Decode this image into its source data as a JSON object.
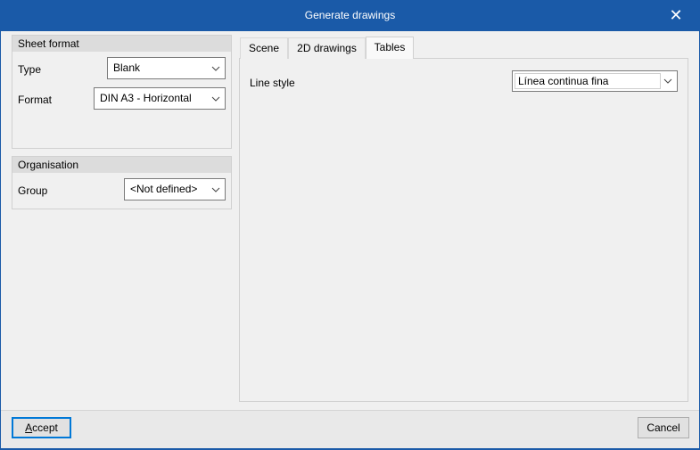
{
  "window": {
    "title": "Generate drawings",
    "close_icon": "close-icon"
  },
  "sheet_format": {
    "header": "Sheet format",
    "type_label": "Type",
    "type_value": "Blank",
    "format_label": "Format",
    "format_value": "DIN A3 - Horizontal"
  },
  "organisation": {
    "header": "Organisation",
    "group_label": "Group",
    "group_value": "<Not defined>"
  },
  "tabs": [
    {
      "label": "Scene"
    },
    {
      "label": "2D drawings"
    },
    {
      "label": "Tables",
      "active": true
    }
  ],
  "tables": {
    "line_style_label": "Line style",
    "line_style_value": "Línea continua fina"
  },
  "footer": {
    "accept_access_key": "A",
    "accept_rest": "ccept",
    "cancel_label": "Cancel"
  }
}
